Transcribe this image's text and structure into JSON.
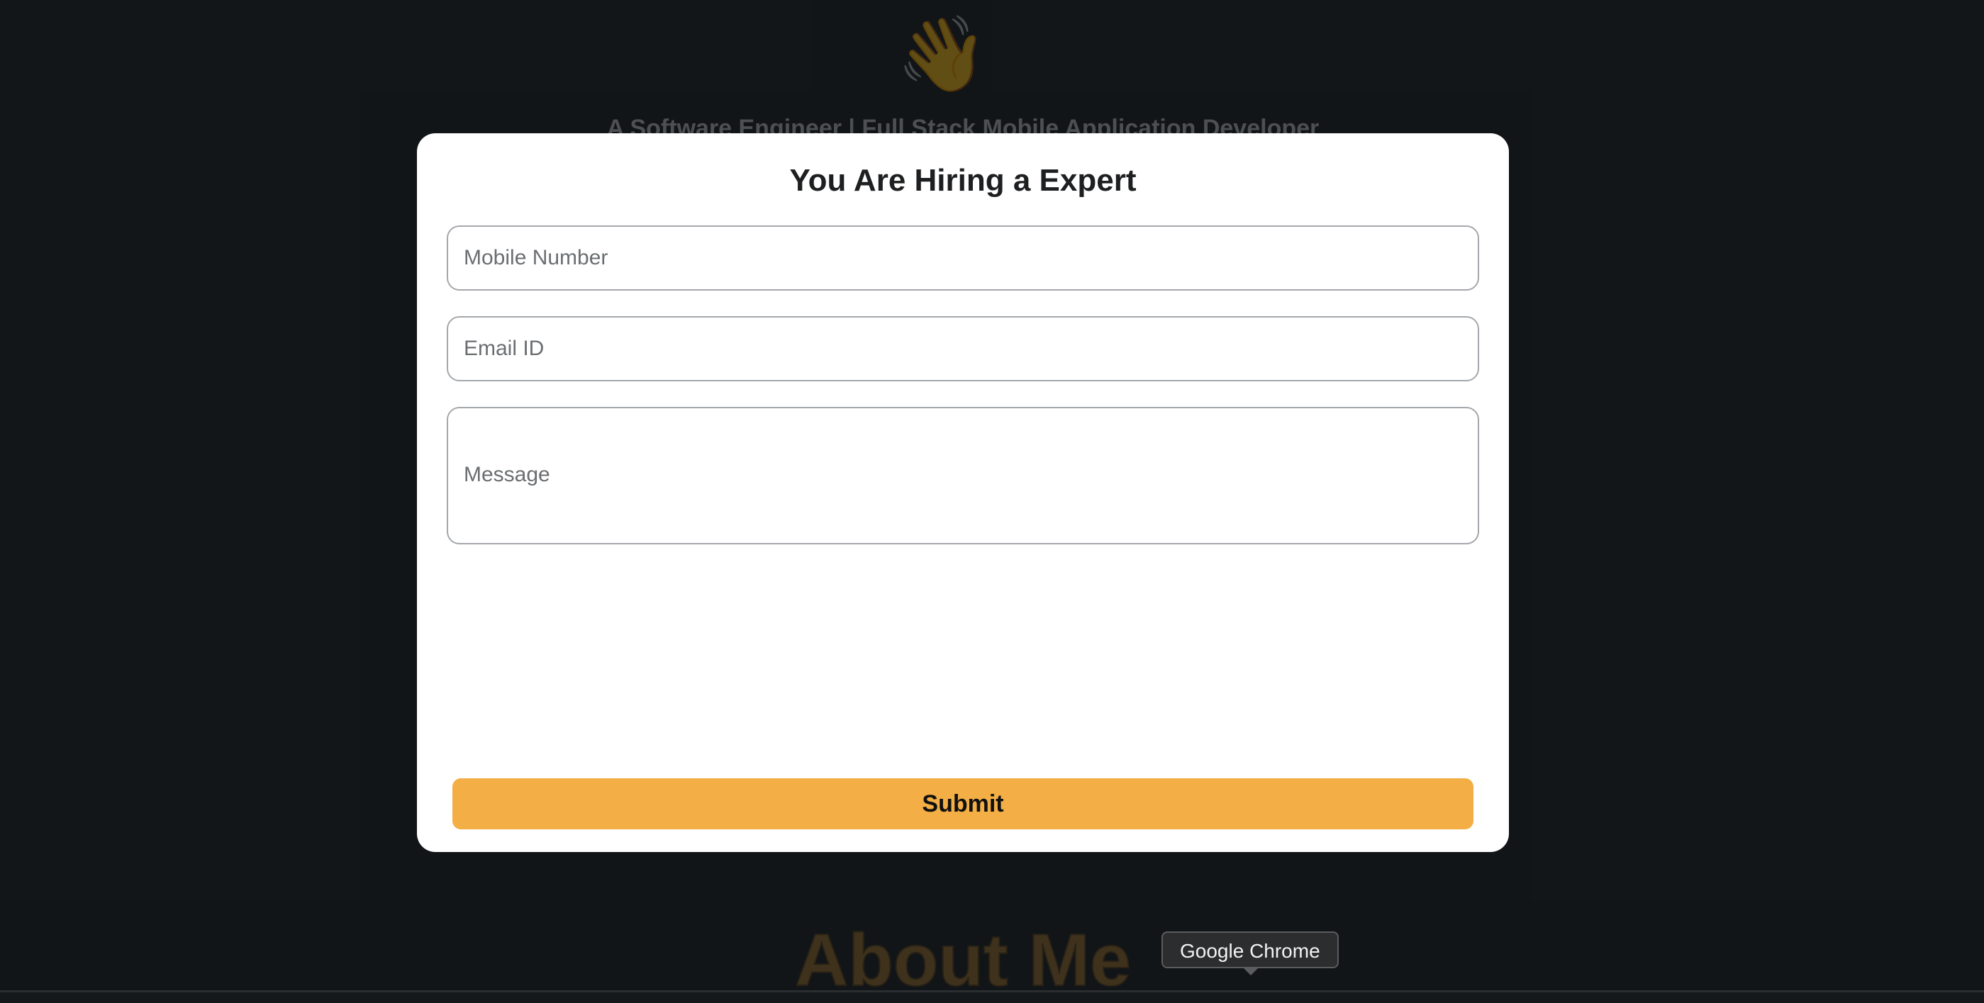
{
  "background": {
    "wave_icon": "waving-hand-icon",
    "tagline": "A Software Engineer | Full Stack Mobile Application Developer",
    "section_heading": "About Me"
  },
  "modal": {
    "title": "You Are Hiring a Expert",
    "fields": {
      "mobile": {
        "placeholder": "Mobile Number",
        "value": ""
      },
      "email": {
        "placeholder": "Email ID",
        "value": ""
      },
      "message": {
        "placeholder": "Message",
        "value": ""
      }
    },
    "submit_label": "Submit"
  },
  "tooltip": {
    "text": "Google Chrome"
  },
  "colors": {
    "page_background": "#14181b",
    "modal_background": "#ffffff",
    "accent": "#f3ae45",
    "heading_muted": "#5a4422"
  }
}
